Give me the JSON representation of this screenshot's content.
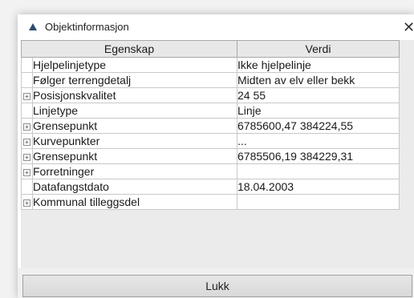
{
  "window": {
    "title": "Objektinformasjon",
    "close_glyph": "✕"
  },
  "table": {
    "headers": [
      "Egenskap",
      "Verdi"
    ],
    "rows": [
      {
        "name": "Hjelpelinjetype",
        "value": "Ikke hjelpelinje",
        "expandable": false
      },
      {
        "name": "Følger terrengdetalj",
        "value": "Midten av elv eller bekk",
        "expandable": false
      },
      {
        "name": "Posisjonskvalitet",
        "value": "24  55",
        "expandable": true
      },
      {
        "name": "Linjetype",
        "value": "Linje",
        "expandable": false
      },
      {
        "name": "Grensepunkt",
        "value": "6785600,47 384224,55",
        "expandable": true
      },
      {
        "name": "Kurvepunkter",
        "value": "...",
        "expandable": true
      },
      {
        "name": "Grensepunkt",
        "value": "6785506,19 384229,31",
        "expandable": true
      },
      {
        "name": "Forretninger",
        "value": "",
        "expandable": true
      },
      {
        "name": "Datafangstdato",
        "value": "18.04.2003",
        "expandable": false
      },
      {
        "name": "Kommunal tilleggsdel",
        "value": "",
        "expandable": true
      }
    ],
    "expander_glyph": "+"
  },
  "footer": {
    "close_label": "Lukk"
  },
  "colors": {
    "title_icon": "#2c4a6e"
  }
}
